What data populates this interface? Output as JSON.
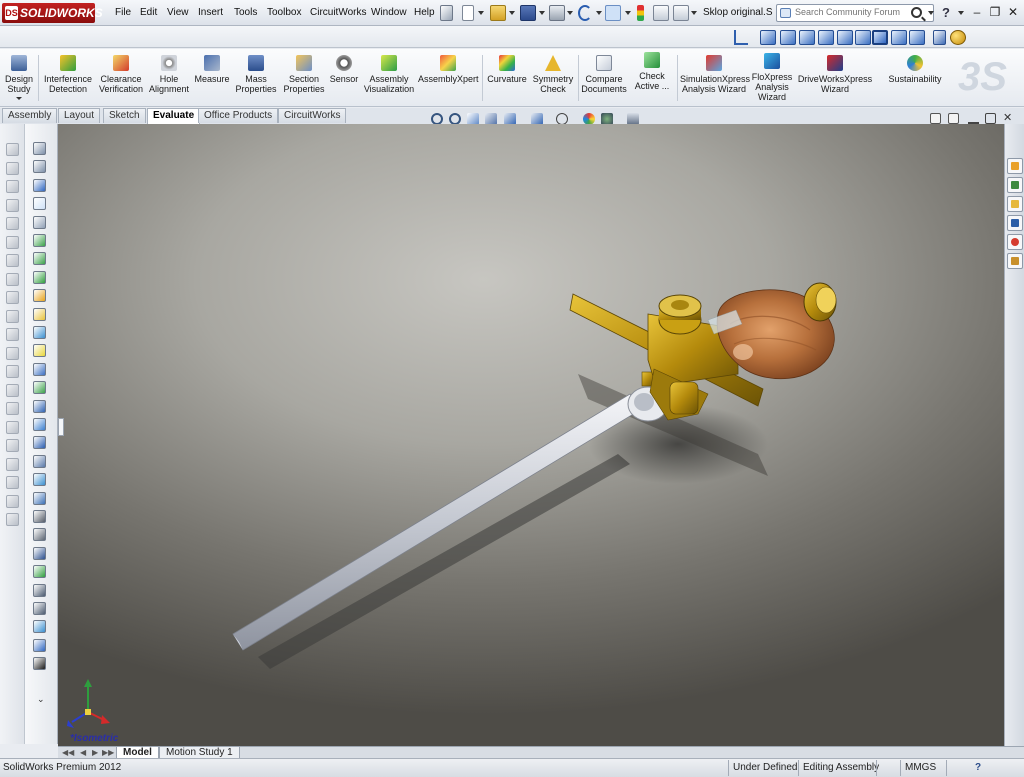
{
  "app": {
    "logo_text": "SOLIDWORKS",
    "logo_mark": "DS",
    "product": "SolidWorks Premium 2012"
  },
  "menu": [
    "File",
    "Edit",
    "View",
    "Insert",
    "Tools",
    "Toolbox",
    "CircuitWorks",
    "Window",
    "Help"
  ],
  "document": {
    "title": "Sklop original.S..."
  },
  "search": {
    "placeholder": "Search Community Forum"
  },
  "help_label": "?",
  "window_controls": {
    "minimize": "–",
    "restore": "❐",
    "close": "✕"
  },
  "command_manager": {
    "design_study": [
      "Design",
      "Study"
    ],
    "interference": [
      "Interference",
      "Detection"
    ],
    "clearance": [
      "Clearance",
      "Verification"
    ],
    "hole_alignment": [
      "Hole",
      "Alignment"
    ],
    "measure": [
      "Measure",
      ""
    ],
    "mass_properties": [
      "Mass",
      "Properties"
    ],
    "section_properties": [
      "Section",
      "Properties"
    ],
    "sensor": [
      "Sensor",
      ""
    ],
    "assembly_visualization": [
      "Assembly",
      "Visualization"
    ],
    "assemblyxpert": [
      "AssemblyXpert",
      ""
    ],
    "curvature": [
      "Curvature",
      ""
    ],
    "symmetry_check": [
      "Symmetry",
      "Check"
    ],
    "compare_documents": [
      "Compare",
      "Documents"
    ],
    "check_active": [
      "Check",
      "Active ..."
    ],
    "simulationxpress": [
      "SimulationXpress",
      "Analysis Wizard"
    ],
    "floxpress": [
      "FloXpress",
      "Analysis",
      "Wizard"
    ],
    "driveworksxpress": [
      "DriveWorksXpress",
      "Wizard"
    ],
    "sustainability": [
      "Sustainability",
      ""
    ]
  },
  "tabs": [
    {
      "label": "Assembly",
      "active": false
    },
    {
      "label": "Layout",
      "active": false
    },
    {
      "label": "Sketch",
      "active": false
    },
    {
      "label": "Evaluate",
      "active": true
    },
    {
      "label": "Office Products",
      "active": false
    },
    {
      "label": "CircuitWorks",
      "active": false
    }
  ],
  "view": {
    "orientation_label": "*Isometric"
  },
  "bottom_tabs": [
    {
      "label": "Model",
      "active": true
    },
    {
      "label": "Motion Study 1",
      "active": false
    }
  ],
  "status": {
    "left": "SolidWorks Premium 2012",
    "fields": [
      "Under Defined",
      "Editing Assembly",
      "MMGS"
    ],
    "help_icon": "?"
  },
  "colors": {
    "brand_red": "#b51616",
    "toolbar_bg": "#e9ecf1",
    "wood": "#b06a36",
    "brass": "#c9a013",
    "steel": "#c9ccd4"
  }
}
